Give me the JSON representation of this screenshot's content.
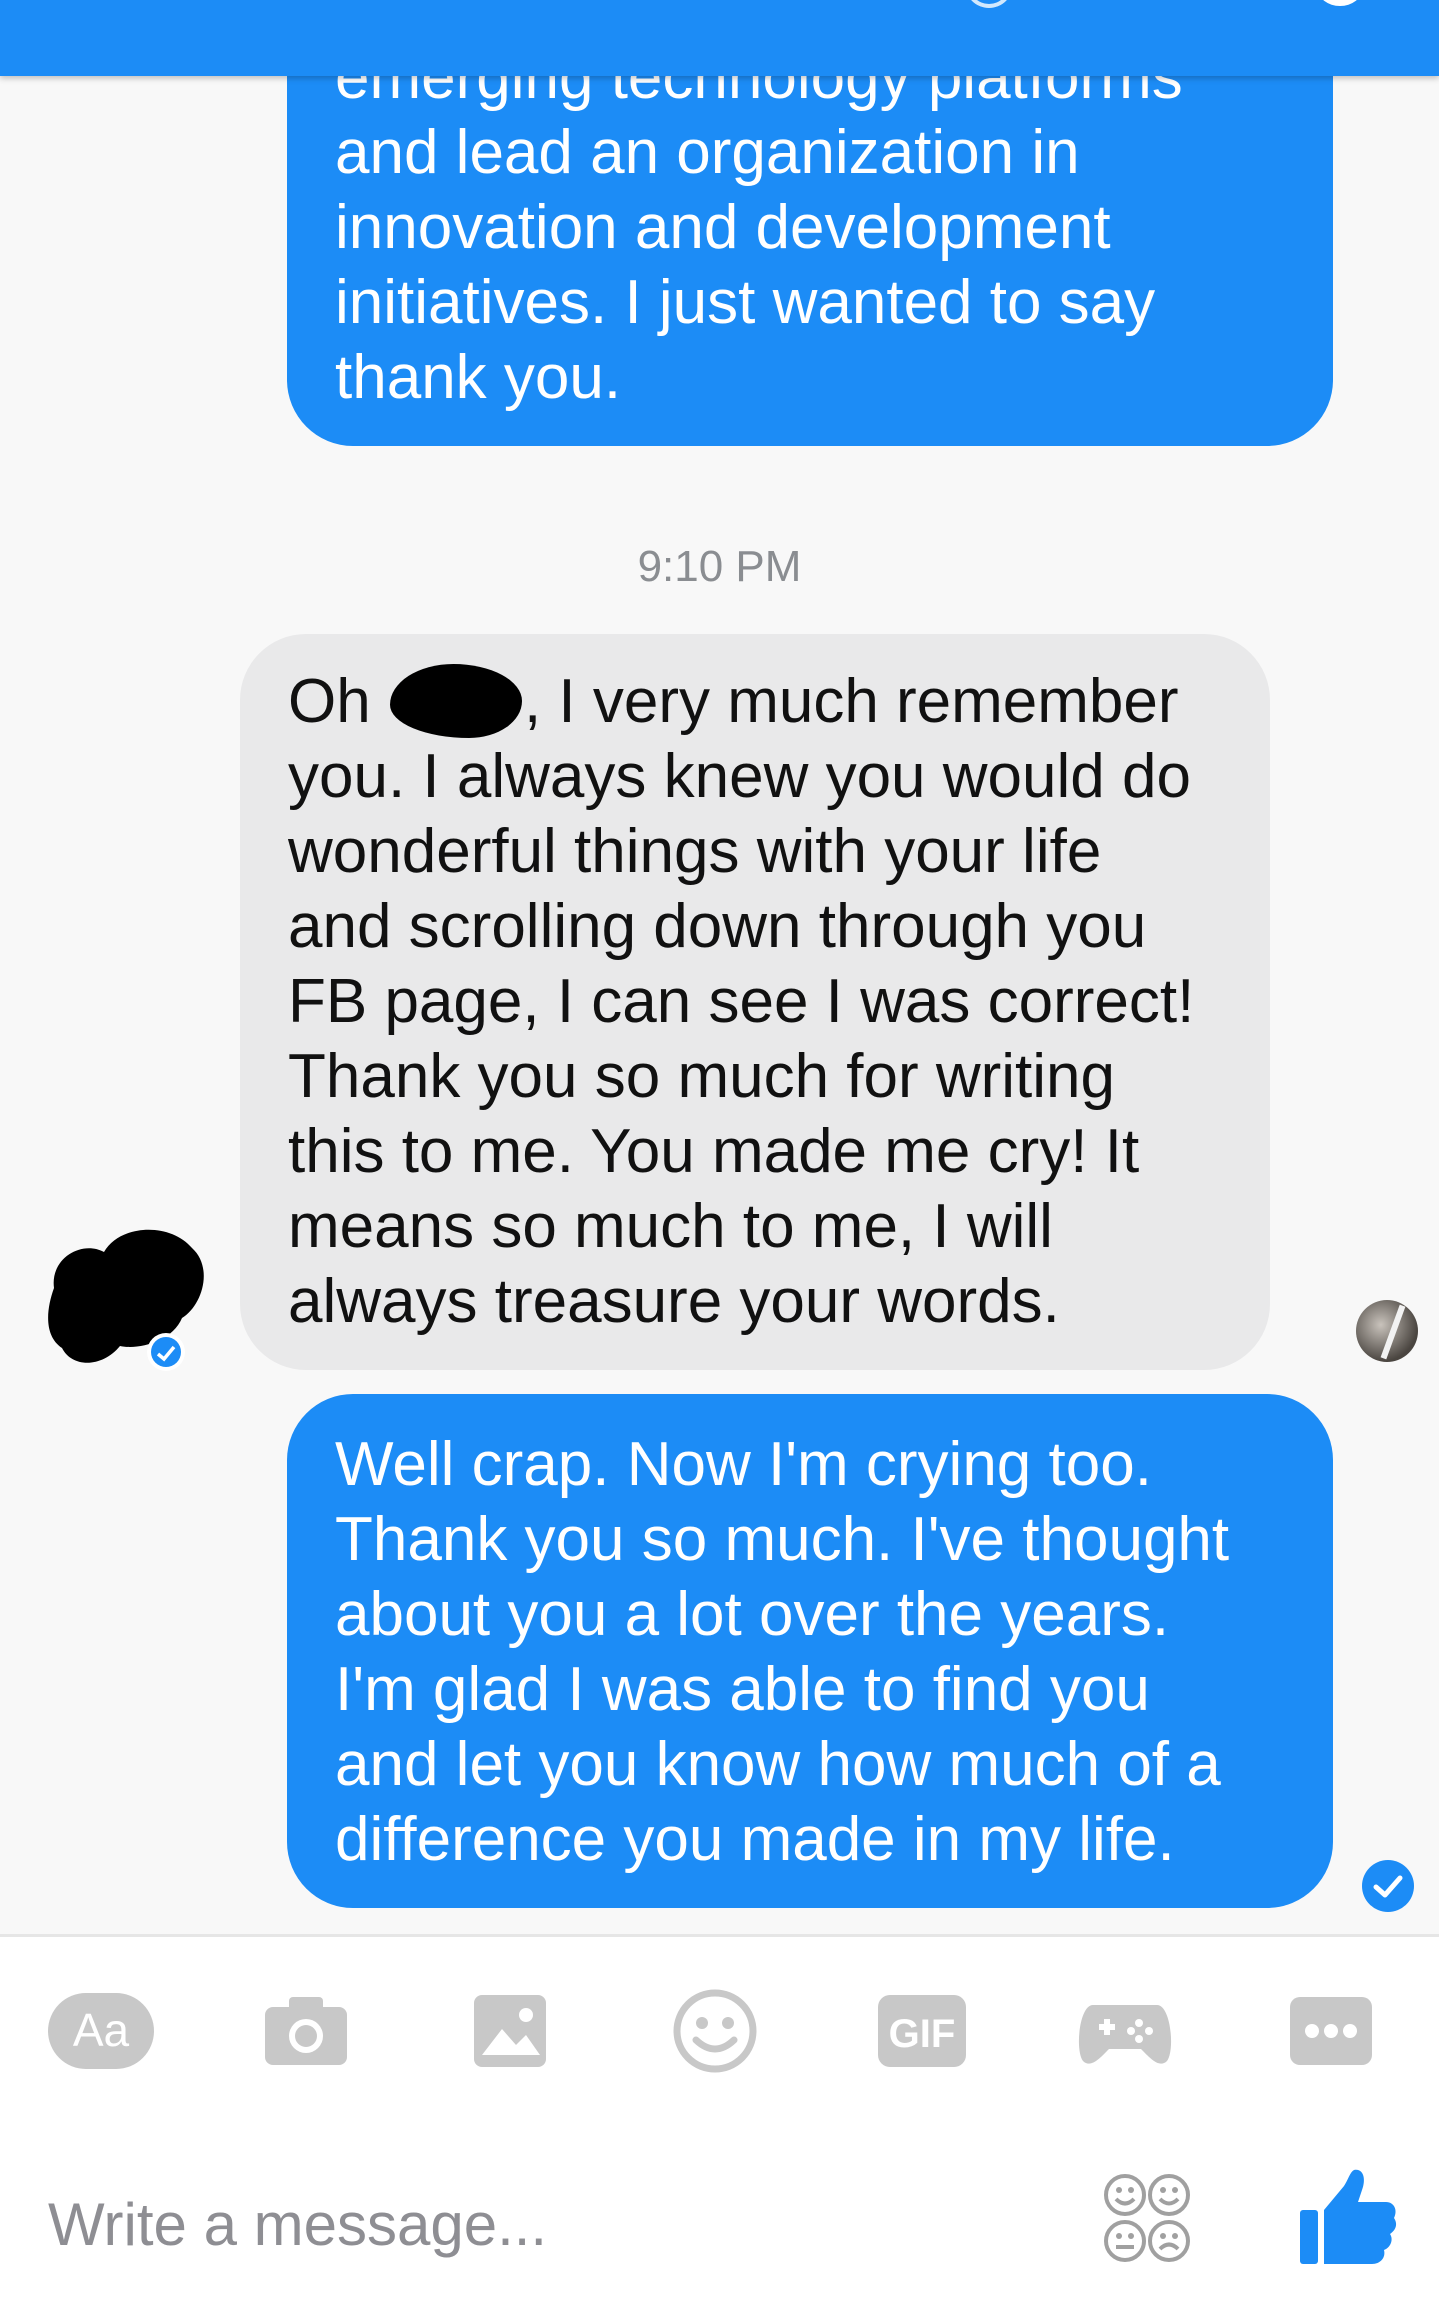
{
  "conversation": {
    "messages": [
      {
        "direction": "outgoing",
        "lines": [
          "emerging technology platforms",
          "and lead an organization in",
          "innovation and development",
          "initiatives. I just wanted to say",
          "thank you."
        ]
      },
      {
        "direction": "incoming",
        "first_line_before": "Oh ",
        "first_line_after": ", I very much remember",
        "lines": [
          "you. I always knew you would do",
          "wonderful things with your life",
          "and scrolling down through you",
          "FB page, I can see I was correct!",
          "Thank you so much for writing",
          "this to me. You made me cry!  It",
          "means so much to me, I will",
          "always treasure your words."
        ]
      },
      {
        "direction": "outgoing",
        "lines": [
          "Well crap. Now I'm crying too.",
          "Thank you so much. I've thought",
          "about you a lot over the years.",
          "I'm glad I was able to find you",
          "and let you know how much of a",
          "difference you made in my life."
        ]
      }
    ],
    "timestamp": "9:10 PM"
  },
  "composer": {
    "placeholder": "Write a message...",
    "toolbar": {
      "text_style_label": "Aa",
      "gif_label": "GIF",
      "icons": [
        "aa-icon",
        "camera-icon",
        "gallery-icon",
        "emoji-icon",
        "gif-icon",
        "game-controller-icon",
        "more-icon"
      ]
    }
  },
  "colors": {
    "messenger_blue": "#1c8cf6",
    "incoming_bubble": "#e9e9ea",
    "toolbar_gray": "#c8c8c8",
    "placeholder_gray": "#8e8e93"
  }
}
